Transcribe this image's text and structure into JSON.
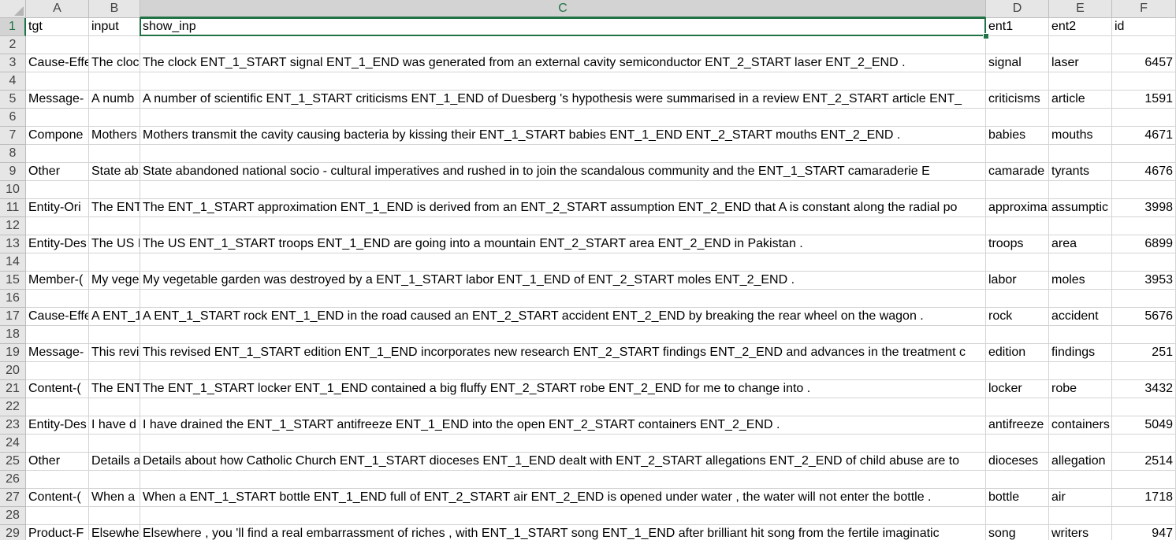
{
  "columns": [
    "A",
    "B",
    "C",
    "D",
    "E",
    "F"
  ],
  "active_cell": {
    "col": "C",
    "row": "1"
  },
  "header_row": {
    "row": "1",
    "cells": [
      "tgt",
      "input",
      "show_inp",
      "ent1",
      "ent2",
      "id"
    ]
  },
  "rows": [
    {
      "num": "2",
      "cells": [
        "",
        "",
        "",
        "",
        "",
        ""
      ]
    },
    {
      "num": "3",
      "cells": [
        "Cause-Effe",
        "The cloc",
        "The clock ENT_1_START signal ENT_1_END was generated from an external cavity semiconductor ENT_2_START laser ENT_2_END .",
        "signal",
        "laser",
        "6457"
      ]
    },
    {
      "num": "4",
      "cells": [
        "",
        "",
        "",
        "",
        "",
        ""
      ]
    },
    {
      "num": "5",
      "cells": [
        "Message-",
        "A numb",
        "A number of scientific ENT_1_START criticisms ENT_1_END of Duesberg 's hypothesis were summarised in a review ENT_2_START article ENT_",
        "criticisms",
        "article",
        "1591"
      ]
    },
    {
      "num": "6",
      "cells": [
        "",
        "",
        "",
        "",
        "",
        ""
      ]
    },
    {
      "num": "7",
      "cells": [
        "Compone",
        "Mothers",
        "Mothers transmit the cavity causing bacteria by kissing their ENT_1_START babies ENT_1_END ENT_2_START mouths ENT_2_END .",
        "babies",
        "mouths",
        "4671"
      ]
    },
    {
      "num": "8",
      "cells": [
        "",
        "",
        "",
        "",
        "",
        ""
      ]
    },
    {
      "num": "9",
      "cells": [
        "Other",
        "State ab",
        "State abandoned national socio - cultural imperatives and rushed in to join the scandalous community and the ENT_1_START camaraderie E",
        "camarade",
        "tyrants",
        "4676"
      ]
    },
    {
      "num": "10",
      "cells": [
        "",
        "",
        "",
        "",
        "",
        ""
      ]
    },
    {
      "num": "11",
      "cells": [
        "Entity-Ori",
        "The ENT",
        "The ENT_1_START approximation ENT_1_END is derived from an ENT_2_START assumption ENT_2_END that A is constant along the radial po",
        "approxima",
        "assumptic",
        "3998"
      ]
    },
    {
      "num": "12",
      "cells": [
        "",
        "",
        "",
        "",
        "",
        ""
      ]
    },
    {
      "num": "13",
      "cells": [
        "Entity-Des",
        "The US I",
        "The US ENT_1_START troops ENT_1_END are going into a mountain ENT_2_START area ENT_2_END in Pakistan .",
        "troops",
        "area",
        "6899"
      ]
    },
    {
      "num": "14",
      "cells": [
        "",
        "",
        "",
        "",
        "",
        ""
      ]
    },
    {
      "num": "15",
      "cells": [
        "Member-(",
        "My vege",
        "My vegetable garden was destroyed by a ENT_1_START labor ENT_1_END of ENT_2_START moles ENT_2_END .",
        "labor",
        "moles",
        "3953"
      ]
    },
    {
      "num": "16",
      "cells": [
        "",
        "",
        "",
        "",
        "",
        ""
      ]
    },
    {
      "num": "17",
      "cells": [
        "Cause-Effe",
        "A ENT_1",
        "A ENT_1_START rock ENT_1_END in the road caused an ENT_2_START accident ENT_2_END by breaking the rear wheel on the wagon .",
        "rock",
        "accident",
        "5676"
      ]
    },
    {
      "num": "18",
      "cells": [
        "",
        "",
        "",
        "",
        "",
        ""
      ]
    },
    {
      "num": "19",
      "cells": [
        "Message-",
        "This revi",
        "This revised ENT_1_START edition ENT_1_END incorporates new research ENT_2_START findings ENT_2_END and advances in the treatment c",
        "edition",
        "findings",
        "251"
      ]
    },
    {
      "num": "20",
      "cells": [
        "",
        "",
        "",
        "",
        "",
        ""
      ]
    },
    {
      "num": "21",
      "cells": [
        "Content-(",
        "The ENT",
        "The ENT_1_START locker ENT_1_END contained a big fluffy ENT_2_START robe ENT_2_END for me to change into .",
        "locker",
        "robe",
        "3432"
      ]
    },
    {
      "num": "22",
      "cells": [
        "",
        "",
        "",
        "",
        "",
        ""
      ]
    },
    {
      "num": "23",
      "cells": [
        "Entity-Des",
        "I have d",
        "I have drained the ENT_1_START antifreeze ENT_1_END into the open ENT_2_START containers ENT_2_END .",
        "antifreeze",
        "containers",
        "5049"
      ]
    },
    {
      "num": "24",
      "cells": [
        "",
        "",
        "",
        "",
        "",
        ""
      ]
    },
    {
      "num": "25",
      "cells": [
        "Other",
        "Details a",
        "Details about how Catholic Church ENT_1_START dioceses ENT_1_END dealt with ENT_2_START allegations ENT_2_END of child abuse are to",
        "dioceses",
        "allegation",
        "2514"
      ]
    },
    {
      "num": "26",
      "cells": [
        "",
        "",
        "",
        "",
        "",
        ""
      ]
    },
    {
      "num": "27",
      "cells": [
        "Content-(",
        "When a",
        "When a ENT_1_START bottle ENT_1_END full of ENT_2_START air ENT_2_END is opened under water , the water will not enter the bottle .",
        "bottle",
        "air",
        "1718"
      ]
    },
    {
      "num": "28",
      "cells": [
        "",
        "",
        "",
        "",
        "",
        ""
      ]
    },
    {
      "num": "29",
      "cells": [
        "Product-F",
        "Elsewhe",
        "Elsewhere , you 'll find a real embarrassment of riches , with ENT_1_START song ENT_1_END after brilliant hit song from the fertile imaginatic",
        "song",
        "writers",
        "947"
      ]
    }
  ]
}
